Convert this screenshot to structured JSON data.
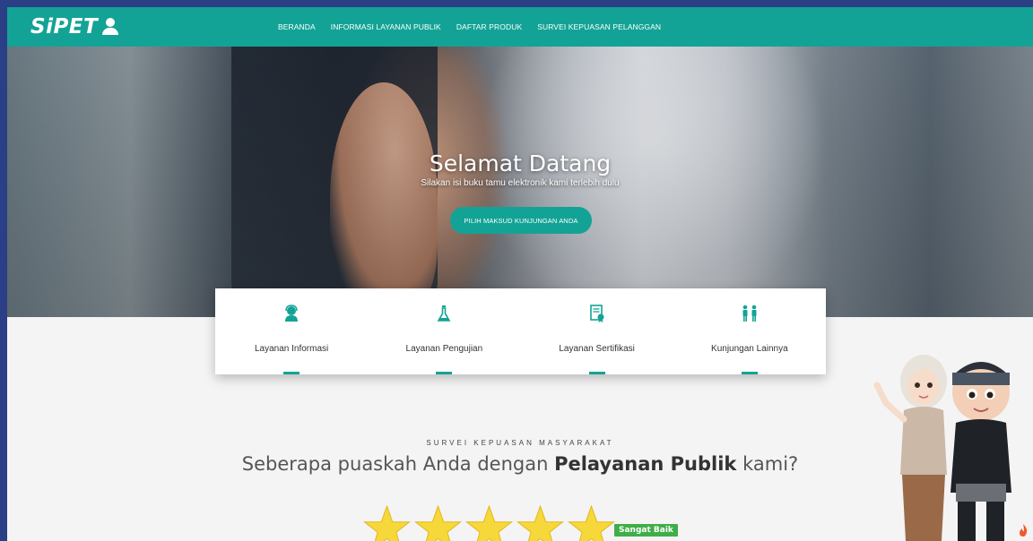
{
  "app": {
    "logo_text": "SiPET"
  },
  "nav": {
    "items": [
      {
        "label": "BERANDA"
      },
      {
        "label": "INFORMASI LAYANAN PUBLIK"
      },
      {
        "label": "DAFTAR PRODUK"
      },
      {
        "label": "SURVEI KEPUASAN PELANGGAN"
      }
    ]
  },
  "hero": {
    "title": "Selamat Datang",
    "subtitle": "Silakan isi buku tamu elektronik kami terlebih dulu",
    "button_label": "PILIH MAKSUD KUNJUNGAN ANDA"
  },
  "services": [
    {
      "label": "Layanan Informasi",
      "icon": "user-headset-icon"
    },
    {
      "label": "Layanan Pengujian",
      "icon": "flask-icon"
    },
    {
      "label": "Layanan Sertifikasi",
      "icon": "certificate-icon"
    },
    {
      "label": "Kunjungan Lainnya",
      "icon": "people-icon"
    }
  ],
  "survey": {
    "kicker": "SURVEI KEPUASAN MASYARAKAT",
    "question_prefix": "Seberapa puaskah Anda dengan ",
    "question_bold": "Pelayanan Publik",
    "question_suffix": " kami?",
    "rating_label": "Sangat Baik",
    "rating_value": 5,
    "rating_max": 5
  },
  "colors": {
    "brand": "#13a396",
    "star": "#f7d83a",
    "badge": "#3fae49"
  }
}
